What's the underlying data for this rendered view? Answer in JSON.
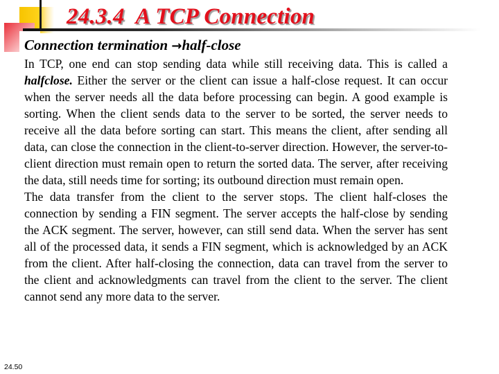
{
  "slide": {
    "title": "24.3.4  A TCP Connection",
    "subtitle": {
      "prefix": "Connection termination",
      "arrow_icon": "right-arrow-icon",
      "arrow_glyph": "→",
      "suffix": "half-close"
    },
    "paragraph1": {
      "part1": "In TCP, one end can stop sending data while still receiving data. This is called a ",
      "emphasis": "halfclose.",
      "part2": " Either the server or the client can issue a half-close request. It can occur when the server needs all the data before processing can begin. A good example is sorting. When the client sends data to the server to be sorted, the server needs to receive all the data before sorting can start. This means the client, after sending all data, can close the connection in the client-to-server direction. However, the server-to-client direction must remain open to return the sorted data. The server, after receiving the data, still needs time for sorting; its outbound direction must remain open."
    },
    "paragraph2": "The data transfer from the client to the server stops. The client half-closes the connection by sending a FIN segment. The server accepts the half-close by sending the ACK segment. The server, however, can still send data. When the server has sent all of the processed data, it sends a FIN segment, which is acknowledged by an ACK from the client. After half-closing the connection, data can travel from the server to the client and acknowledgments can travel from the client to the server. The client cannot send any more data to the server.",
    "page_number": "24.50",
    "colors": {
      "title": "#e3101c",
      "accent_yellow": "#f7c400",
      "accent_red": "#e9303a"
    }
  }
}
